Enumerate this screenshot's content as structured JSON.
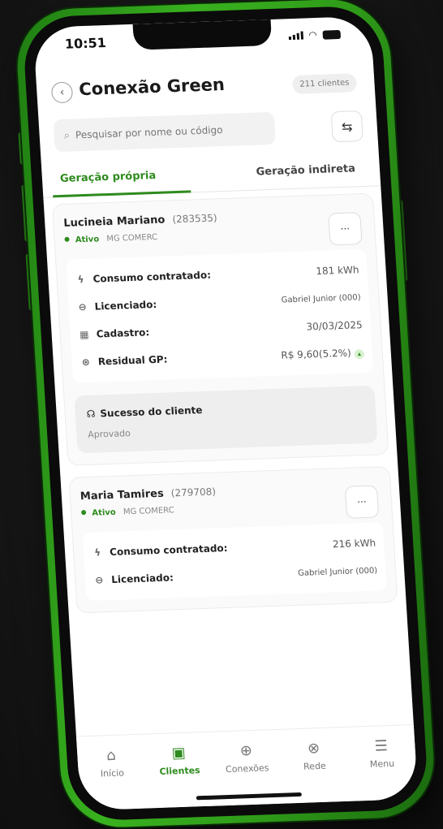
{
  "status_bar": {
    "time": "10:51"
  },
  "header": {
    "title": "Conexão Green",
    "clients_count": "211 clientes"
  },
  "search": {
    "placeholder": "Pesquisar por nome ou código"
  },
  "tabs": [
    {
      "label": "Geração própria",
      "active": true
    },
    {
      "label": "Geração indireta",
      "active": false
    }
  ],
  "labels": {
    "consumo": "Consumo contratado:",
    "licenciado": "Licenciado:",
    "cadastro": "Cadastro:",
    "residual": "Residual GP:",
    "sucesso": "Sucesso do cliente",
    "more": "···"
  },
  "clients": [
    {
      "name": "Lucineia Mariano",
      "code": "(283535)",
      "status": "Ativo",
      "plan": "MG COMERC",
      "consumo": "181 kWh",
      "licenciado": "Gabriel Junior (000)",
      "cadastro": "30/03/2025",
      "residual": "R$ 9,60(5.2%)",
      "sucesso": "Aprovado"
    },
    {
      "name": "Maria Tamires",
      "code": "(279708)",
      "status": "Ativo",
      "plan": "MG COMERC",
      "consumo": "216 kWh",
      "licenciado": "Gabriel Junior (000)"
    }
  ],
  "bottom_nav": [
    {
      "label": "Início",
      "icon": "home-icon",
      "active": false
    },
    {
      "label": "Clientes",
      "icon": "clients-icon",
      "active": true
    },
    {
      "label": "Conexões",
      "icon": "plus-circle-icon",
      "active": false
    },
    {
      "label": "Rede",
      "icon": "globe-icon",
      "active": false
    },
    {
      "label": "Menu",
      "icon": "menu-icon",
      "active": false
    }
  ],
  "colors": {
    "brand_green": "#2e8b1e",
    "frame_green": "#39b21f"
  }
}
